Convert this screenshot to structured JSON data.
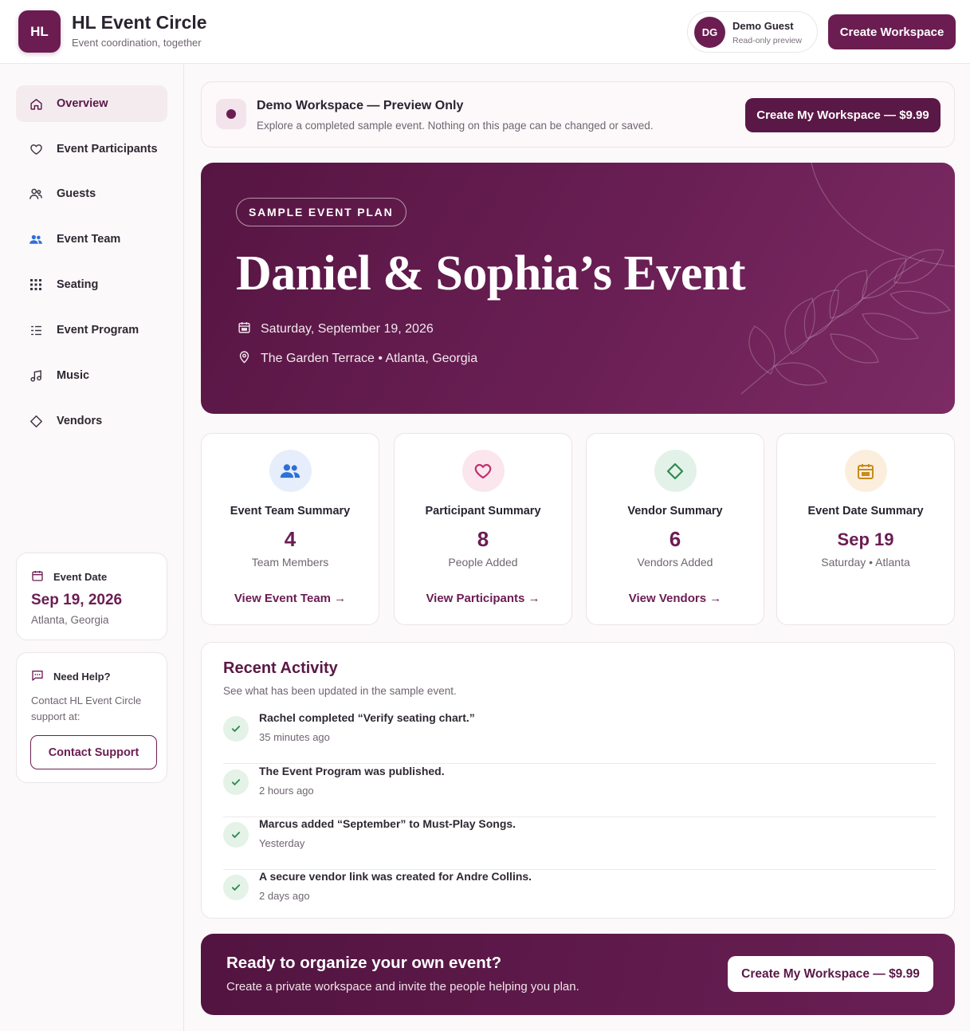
{
  "header": {
    "logo_text": "HL",
    "brand_name": "HL Event Circle",
    "tagline": "Event coordination, together",
    "user": {
      "initials": "DG",
      "name": "Demo Guest",
      "role": "Read-only preview"
    },
    "create_workspace_label": "Create Workspace"
  },
  "sidebar": {
    "items": [
      {
        "label": "Overview",
        "icon": "home-icon",
        "active": true
      },
      {
        "label": "Event Participants",
        "icon": "heart-icon",
        "active": false
      },
      {
        "label": "Guests",
        "icon": "guests-icon",
        "active": false
      },
      {
        "label": "Event Team",
        "icon": "team-icon",
        "active": false
      },
      {
        "label": "Seating",
        "icon": "grid-icon",
        "active": false
      },
      {
        "label": "Event Program",
        "icon": "list-icon",
        "active": false
      },
      {
        "label": "Music",
        "icon": "music-note-icon",
        "active": false
      },
      {
        "label": "Vendors",
        "icon": "diamond-icon",
        "active": false
      }
    ],
    "date_card": {
      "heading": "Event Date",
      "date": "Sep 19, 2026",
      "location": "Atlanta, Georgia"
    },
    "help_card": {
      "heading": "Need Help?",
      "text": "Contact HL Event Circle support at:",
      "button_label": "Contact Support"
    }
  },
  "demo_banner": {
    "title": "Demo Workspace — Preview Only",
    "subtitle": "Explore a completed sample event. Nothing on this page can be changed or saved.",
    "button_label": "Create My Workspace — $9.99"
  },
  "hero": {
    "pill": "SAMPLE EVENT PLAN",
    "title": "Daniel & Sophia’s Event",
    "date": "Saturday, September 19, 2026",
    "location": "The Garden Terrace • Atlanta, Georgia"
  },
  "summary_cards": [
    {
      "title": "Event Team Summary",
      "value": "4",
      "subtitle": "Team Members",
      "link": "View Event Team →",
      "icon": "team-icon",
      "icon_bg": "#e6eefb",
      "icon_color": "#2f6fd6"
    },
    {
      "title": "Participant Summary",
      "value": "8",
      "subtitle": "People Added",
      "link": "View Participants →",
      "icon": "heart-icon",
      "icon_bg": "#fbe6ee",
      "icon_color": "#c0336e"
    },
    {
      "title": "Vendor Summary",
      "value": "6",
      "subtitle": "Vendors Added",
      "link": "View Vendors →",
      "icon": "diamond-icon",
      "icon_bg": "#e3f2e8",
      "icon_color": "#2e8a52"
    },
    {
      "title": "Event Date Summary",
      "value": "Sep 19",
      "subtitle": "Saturday • Atlanta",
      "link": "",
      "icon": "calendar-icon",
      "icon_bg": "#fbeedd",
      "icon_color": "#c98a1e"
    }
  ],
  "activity": {
    "title": "Recent Activity",
    "subtitle": "See what has been updated in the sample event.",
    "items": [
      {
        "text": "Rachel completed “Verify seating chart.”",
        "time": "35 minutes ago"
      },
      {
        "text": "The Event Program was published.",
        "time": "2 hours ago"
      },
      {
        "text": "Marcus added “September” to Must-Play Songs.",
        "time": "Yesterday"
      },
      {
        "text": "A secure vendor link was created for Andre Collins.",
        "time": "2 days ago"
      }
    ]
  },
  "cta": {
    "title": "Ready to organize your own event?",
    "subtitle": "Create a private workspace and invite the people helping you plan.",
    "button_label": "Create My Workspace — $9.99"
  },
  "colors": {
    "brand": "#6b1d52",
    "brand_dark": "#5a1846",
    "success": "#2e8a52"
  }
}
